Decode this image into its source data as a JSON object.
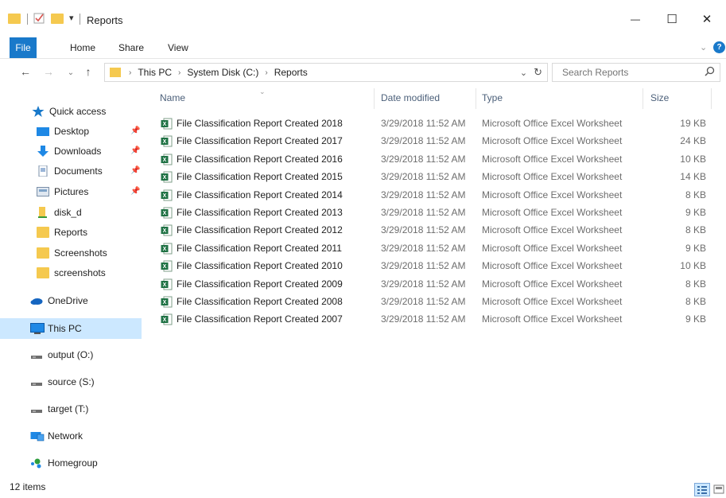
{
  "window": {
    "title": "Reports",
    "controls": {
      "minimize": "—",
      "maximize": "☐",
      "close": "✕"
    }
  },
  "ribbon": {
    "tabs": [
      "File",
      "Home",
      "Share",
      "View"
    ]
  },
  "address": {
    "breadcrumbs": [
      "This PC",
      "System Disk (C:)",
      "Reports"
    ],
    "search_placeholder": "Search Reports"
  },
  "nav": {
    "quick_access": "Quick access",
    "pinned": [
      {
        "label": "Desktop",
        "icon": "desktop-icon"
      },
      {
        "label": "Downloads",
        "icon": "downloads-icon"
      },
      {
        "label": "Documents",
        "icon": "documents-icon"
      },
      {
        "label": "Pictures",
        "icon": "pictures-icon"
      }
    ],
    "folders": [
      {
        "label": "disk_d",
        "icon": "disk-folder-icon"
      },
      {
        "label": "Reports",
        "icon": "folder-icon"
      },
      {
        "label": "Screenshots",
        "icon": "folder-icon"
      },
      {
        "label": "screenshots",
        "icon": "folder-icon"
      }
    ],
    "onedrive": "OneDrive",
    "this_pc": "This PC",
    "drives": [
      "output (O:)",
      "source (S:)",
      "target (T:)"
    ],
    "network": "Network",
    "homegroup": "Homegroup"
  },
  "columns": {
    "name": "Name",
    "date": "Date modified",
    "type": "Type",
    "size": "Size"
  },
  "files": [
    {
      "name": "File Classification Report Created 2018",
      "date": "3/29/2018 11:52 AM",
      "type": "Microsoft Office Excel Worksheet",
      "size": "19 KB"
    },
    {
      "name": "File Classification Report Created 2017",
      "date": "3/29/2018 11:52 AM",
      "type": "Microsoft Office Excel Worksheet",
      "size": "24 KB"
    },
    {
      "name": "File Classification Report Created 2016",
      "date": "3/29/2018 11:52 AM",
      "type": "Microsoft Office Excel Worksheet",
      "size": "10 KB"
    },
    {
      "name": "File Classification Report Created 2015",
      "date": "3/29/2018 11:52 AM",
      "type": "Microsoft Office Excel Worksheet",
      "size": "14 KB"
    },
    {
      "name": "File Classification Report Created 2014",
      "date": "3/29/2018 11:52 AM",
      "type": "Microsoft Office Excel Worksheet",
      "size": "8 KB"
    },
    {
      "name": "File Classification Report Created 2013",
      "date": "3/29/2018 11:52 AM",
      "type": "Microsoft Office Excel Worksheet",
      "size": "9 KB"
    },
    {
      "name": "File Classification Report Created 2012",
      "date": "3/29/2018 11:52 AM",
      "type": "Microsoft Office Excel Worksheet",
      "size": "8 KB"
    },
    {
      "name": "File Classification Report Created 2011",
      "date": "3/29/2018 11:52 AM",
      "type": "Microsoft Office Excel Worksheet",
      "size": "9 KB"
    },
    {
      "name": "File Classification Report Created 2010",
      "date": "3/29/2018 11:52 AM",
      "type": "Microsoft Office Excel Worksheet",
      "size": "10 KB"
    },
    {
      "name": "File Classification Report Created 2009",
      "date": "3/29/2018 11:52 AM",
      "type": "Microsoft Office Excel Worksheet",
      "size": "8 KB"
    },
    {
      "name": "File Classification Report Created 2008",
      "date": "3/29/2018 11:52 AM",
      "type": "Microsoft Office Excel Worksheet",
      "size": "8 KB"
    },
    {
      "name": "File Classification Report Created 2007",
      "date": "3/29/2018 11:52 AM",
      "type": "Microsoft Office Excel Worksheet",
      "size": "9 KB"
    }
  ],
  "status": {
    "item_count": "12 items"
  },
  "colors": {
    "accent": "#1979ca",
    "folder": "#f5c94f",
    "excel": "#1f7244",
    "selected": "#cce8ff"
  }
}
